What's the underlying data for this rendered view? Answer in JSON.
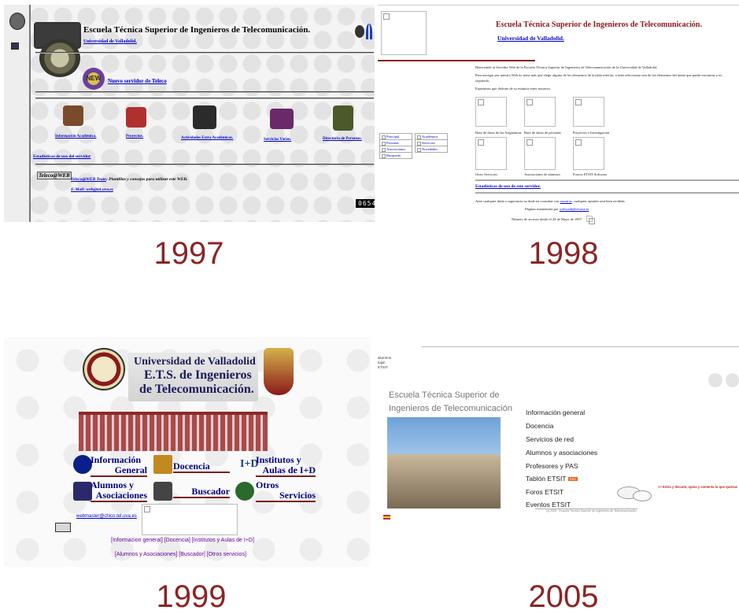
{
  "captions": {
    "y1997": "1997",
    "y1998": "1998",
    "y1999": "1999",
    "y2005": "2005"
  },
  "p1997": {
    "title": "Escuela Técnica Superior de Ingenieros de Telecomunicación.",
    "univ_link": "Universidad de Valladolid.",
    "new_badge": "NEW",
    "new_server_link": "Nuevo servidor de Teleco",
    "icons": [
      {
        "label": "Información Académica.",
        "color": "#7a4a2a"
      },
      {
        "label": "Proyectos.",
        "color": "#b03030"
      },
      {
        "label": "Actividades Extra Académicas.",
        "color": "#2b2b2b"
      },
      {
        "label": "Servicios Varios.",
        "color": "#6a2a6a"
      },
      {
        "label": "Directorio de Personas.",
        "color": "#4a5a2a"
      }
    ],
    "stats_link": "Estadisticas de uso del servidor",
    "team_logo": "Teleco@WEB",
    "team_link": "Teleco@WEB Team",
    "team_text": ": Plantillas y consejos para utilizar este WEB.",
    "email_link": "E-Mail: web@tel.uva.es",
    "counter": "06549"
  },
  "p1998": {
    "title": "Escuela Técnica Superior de Ingenieros de Telecomunicación.",
    "univ_link": "Universidad de Valladolid.",
    "welcome": "Bienvenido al Servidor Web de la Escuela Técnica Superior de Ingenieros de Telecomunicación de la Universidad de Valladolid.",
    "nav_help_1": "Para navegar por nuestro Web no tiene más que elegir alguno de los elementos de la tabla inferior, o bien seleccionar uno de los elementos del menú que puede encontrar a su",
    "nav_help_2": "izquierda.",
    "hope": "Esperamos que disfrute de su estancia entre nosotros.",
    "grid": [
      "Base de datos de las Asignaturas",
      "Base de datos de personas",
      "Proyectos e Investigación",
      "Otros Servicios",
      "Asociaciones de alumnos",
      "Foroos ETSIT Software"
    ],
    "menu": [
      "Principal",
      "Académica",
      "Personas",
      "Servicios",
      "Asociaciones",
      "Novedades",
      "Busqueda"
    ],
    "stats_link": "Estadísticas de uso de este servidor.",
    "contact_pre": "Ante cualquier duda o sugerencia no dude en consultar con",
    "contact_link": "nosotros",
    "contact_post": ", cualquier opinión será bien recibida.",
    "maint_pre": "Páginas mantenidas por",
    "maint_link": "webwadi@tel.uva.es",
    "access": "Número de accesos desde el 24 de Mayo de 1997:"
  },
  "p1999": {
    "title_1": "Universidad de Valladolid",
    "title_2": "E.T.S. de Ingenieros",
    "title_3": "de Telecomunicación.",
    "nav": [
      {
        "l1": "Información",
        "l2": "General",
        "color": "#0a1f8a"
      },
      {
        "l1": "Docencia",
        "l2": "",
        "color": "#c08a20"
      },
      {
        "l1": "Institutos y",
        "l2": "Aulas de I+D",
        "color": "#1a3a8a"
      },
      {
        "l1": "Alumnos y",
        "l2": "Asociaciones",
        "color": "#2a2a6a"
      },
      {
        "l1": "Buscador",
        "l2": "",
        "color": "#444444"
      },
      {
        "l1": "Otros",
        "l2": "Servicios",
        "color": "#2a6a2a"
      }
    ],
    "email": "webmaster@chico.tel.uva.es",
    "links_row1": "[Informacion general] [Docencia] [Institutos y Aulas de I+D]",
    "links_row2": "[Alumnos y Asociaciones] [Buscador] [Otros servicios]"
  },
  "p2005": {
    "top_links": [
      "alumnos",
      "login",
      "ETSIT"
    ],
    "title_1": "Escuela Técnica Superior de",
    "title_2": "Ingenieros de Telecomunicación",
    "menu": [
      "Información general",
      "Docencia",
      "Servicios de red",
      "Alumnos y asociaciones",
      "Profesores y PAS",
      "Tablón ETSIT",
      "Foros ETSIT",
      "Eventos ETSIT"
    ],
    "rss_badge": "RSS",
    "promo": ">> Entra y discute, opina y comenta lo que quieras",
    "copyright": "(c) 2005 · Escuela Técnica Superior de Ingenieros de Telecomunicación"
  }
}
